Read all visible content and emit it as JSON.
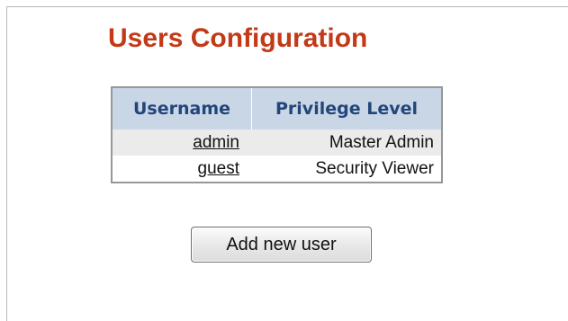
{
  "page": {
    "title": "Users Configuration"
  },
  "users_table": {
    "columns": [
      "Username",
      "Privilege Level"
    ],
    "rows": [
      {
        "username": "admin",
        "privilege": "Master Admin"
      },
      {
        "username": "guest",
        "privilege": "Security Viewer"
      }
    ]
  },
  "actions": {
    "add_user_label": "Add new user"
  },
  "colors": {
    "title": "#c23a17",
    "header_bg": "#c8d6e6",
    "header_text": "#22467a",
    "row_alt_bg": "#ebebeb",
    "table_border": "#979797"
  }
}
